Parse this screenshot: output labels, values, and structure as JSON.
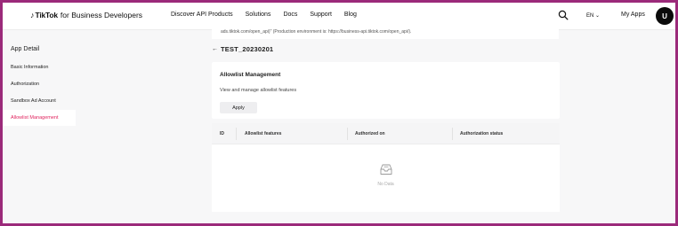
{
  "nav": {
    "brand": "TikTok",
    "brand_suffix": "for Business Developers",
    "links": [
      "Discover API Products",
      "Solutions",
      "Docs",
      "Support",
      "Blog"
    ],
    "language": "EN",
    "my_apps": "My Apps",
    "avatar_initial": "U"
  },
  "sidebar": {
    "title": "App Detail",
    "items": [
      {
        "label": "Basic Information"
      },
      {
        "label": "Authorization"
      },
      {
        "label": "Sandbox Ad Account"
      },
      {
        "label": "Allowlist Management",
        "active": true
      }
    ]
  },
  "main": {
    "partial_text": "ads.tiktok.com/open_api)\" (Production environment is: https://business-api.tiktok.com/open_api/).",
    "app_name": "TEST_20230201",
    "allowlist": {
      "title": "Allowlist Management",
      "description": "View and manage allowlist features",
      "apply_label": "Apply"
    },
    "table": {
      "columns": [
        "ID",
        "Allowlist features",
        "Authorized on",
        "Authorization status"
      ],
      "empty_text": "No Data"
    }
  },
  "colors": {
    "accent": "#e0245e",
    "border_frame": "#9b2a7a"
  },
  "icons": [
    "search-icon",
    "chevron-down-icon",
    "back-arrow-icon",
    "empty-inbox-icon"
  ]
}
